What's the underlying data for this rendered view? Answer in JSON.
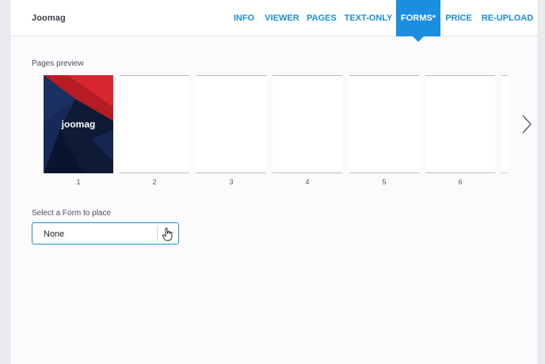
{
  "app": {
    "brand": "Joomag"
  },
  "nav": {
    "tabs": [
      {
        "label": "INFO",
        "active": false
      },
      {
        "label": "VIEWER",
        "active": false
      },
      {
        "label": "PAGES",
        "active": false
      },
      {
        "label": "TEXT-ONLY",
        "active": false
      },
      {
        "label": "FORMS*",
        "active": true
      },
      {
        "label": "PRICE",
        "active": false
      },
      {
        "label": "RE-UPLOAD",
        "active": false
      }
    ]
  },
  "preview": {
    "label": "Pages preview",
    "cover_logo": "joomag",
    "pages": [
      "1",
      "2",
      "3",
      "4",
      "5",
      "6"
    ]
  },
  "form_select": {
    "label": "Select a Form to place",
    "value": "None"
  },
  "colors": {
    "accent": "#1a8fe0",
    "cover_red": "#c8202a",
    "cover_navy": "#12203f"
  },
  "icons": {
    "next": "chevron-right-icon",
    "cursor": "hand-pointer-icon"
  }
}
